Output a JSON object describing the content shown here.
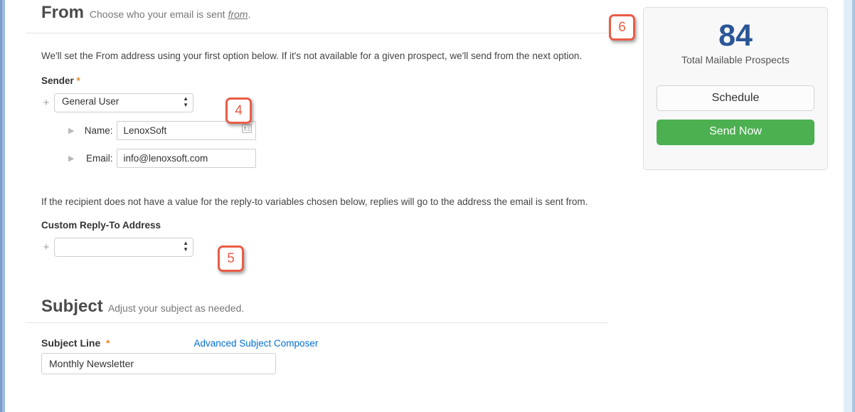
{
  "from_section": {
    "title": "From",
    "subtitle_prefix": "Choose who your email is sent ",
    "subtitle_em": "from",
    "subtitle_suffix": ".",
    "intro": "We'll set the From address using your first option below. If it's not available for a given prospect, we'll send from the next option.",
    "sender_label": "Sender",
    "sender_select_value": "General User",
    "name_label": "Name:",
    "name_value": "LenoxSoft",
    "email_label": "Email:",
    "email_value": "info@lenoxsoft.com",
    "reply_helper": "If the recipient does not have a value for the reply-to variables chosen below, replies will go to the address the email is sent from.",
    "reply_label": "Custom Reply-To Address",
    "reply_select_value": ""
  },
  "subject_section": {
    "title": "Subject",
    "subtitle": "Adjust your subject as needed.",
    "subject_label": "Subject Line",
    "advanced_link": "Advanced Subject Composer",
    "subject_value": "Monthly Newsletter"
  },
  "sidebar": {
    "count": "84",
    "count_label": "Total Mailable Prospects",
    "schedule_label": "Schedule",
    "send_label": "Send Now"
  },
  "callouts": {
    "c4": "4",
    "c5": "5",
    "c6": "6"
  }
}
